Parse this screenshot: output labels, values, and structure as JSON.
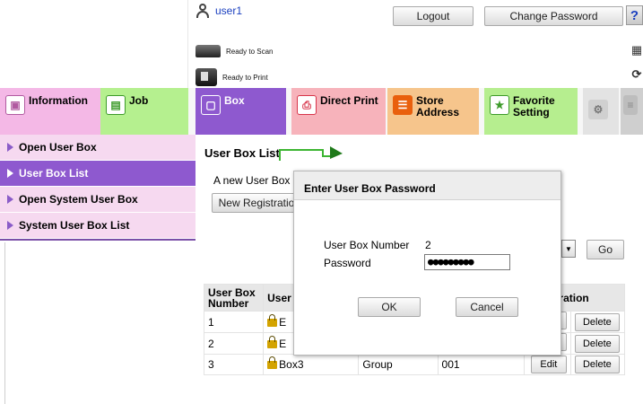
{
  "header": {
    "username": "user1",
    "logout_label": "Logout",
    "change_password_label": "Change Password",
    "help_label": "?",
    "status_scan": "Ready to Scan",
    "status_print": "Ready to Print"
  },
  "tabs": [
    {
      "label": "Information",
      "color": "#f4b8e6",
      "icon": "information-icon"
    },
    {
      "label": "Job",
      "color": "#b5f08f",
      "icon": "job-icon"
    },
    {
      "label": "Box",
      "color": "#8e59cf",
      "icon": "box-icon"
    },
    {
      "label": "Direct Print",
      "color": "#f7b3bb",
      "icon": "direct-print-icon"
    },
    {
      "label": "Store\nAddress",
      "color": "#f6c58c",
      "icon": "store-address-icon"
    },
    {
      "label": "Favorite\nSetting",
      "color": "#b6ee8f",
      "icon": "favorite-setting-icon"
    }
  ],
  "sidebar": {
    "items": [
      {
        "label": "Open User Box"
      },
      {
        "label": "User Box List"
      },
      {
        "label": "Open System User Box"
      },
      {
        "label": "System User Box List"
      }
    ]
  },
  "main": {
    "title": "User Box List",
    "description": "A new User Box",
    "new_registration_label": "New Registratio",
    "go_label": "Go",
    "table": {
      "headers": [
        "User Box\nNumber",
        "User",
        "",
        "",
        "eration"
      ],
      "rows": [
        {
          "number": "1",
          "name": "E",
          "type": "",
          "owner": "",
          "edit": "",
          "delete": "Delete"
        },
        {
          "number": "2",
          "name": "E",
          "type": "",
          "owner": "",
          "edit": "",
          "delete": "Delete"
        },
        {
          "number": "3",
          "name": "Box3",
          "type": "Group",
          "owner": "001",
          "edit": "Edit",
          "delete": "Delete"
        }
      ]
    }
  },
  "dialog": {
    "title": "Enter User Box Password",
    "box_number_label": "User Box Number",
    "box_number_value": "2",
    "password_label": "Password",
    "password_value": "●●●●●●●●●",
    "ok_label": "OK",
    "cancel_label": "Cancel"
  },
  "colors": {
    "accent_purple": "#8e59cf",
    "sidebar_bg": "#f6d9f0",
    "user_link": "#1a3fbf"
  }
}
